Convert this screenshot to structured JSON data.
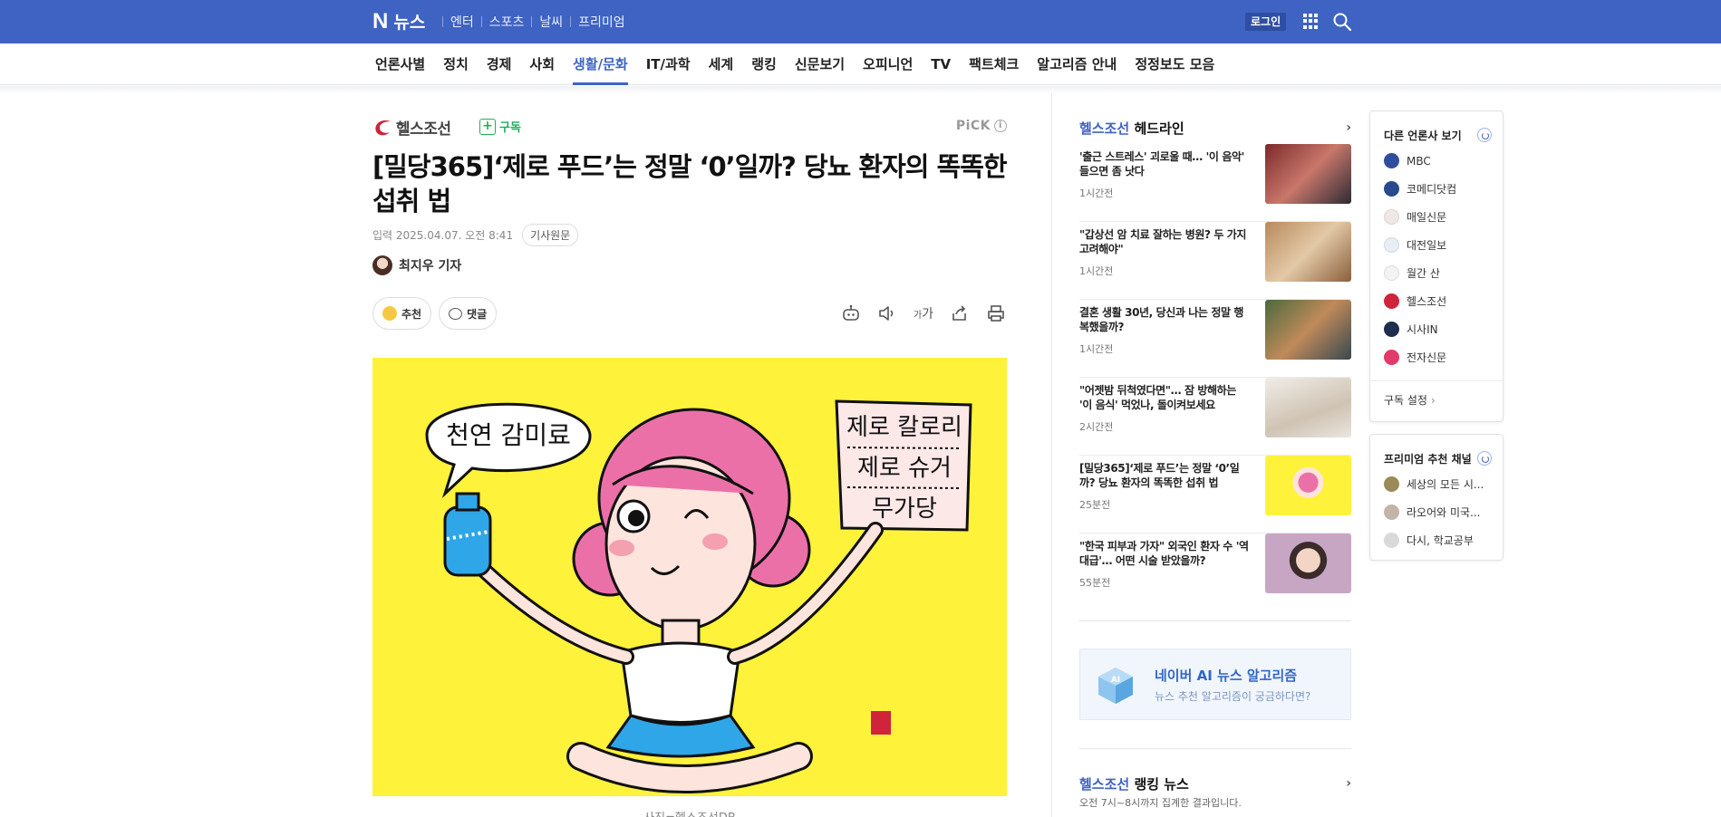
{
  "topbar": {
    "logo_n": "N",
    "logo_text": "뉴스",
    "services": [
      "엔터",
      "스포츠",
      "날씨",
      "프리미엄"
    ],
    "login": "로그인"
  },
  "nav": {
    "items": [
      "언론사별",
      "정치",
      "경제",
      "사회",
      "생활/문화",
      "IT/과학",
      "세계",
      "랭킹",
      "신문보기",
      "오피니언",
      "TV",
      "팩트체크",
      "알고리즘 안내",
      "정정보도 모음"
    ],
    "active": "생활/문화"
  },
  "article": {
    "press": "헬스조선",
    "subscribe": "구독",
    "pick": "PiCK",
    "headline": "[밀당365]‘제로 푸드’는 정말 ‘0’일까? 당뇨 환자의 똑똑한 섭취 법",
    "date": "입력 2025.04.07. 오전 8:41",
    "original": "기사원문",
    "reporter": "최지우 기자",
    "like": "추천",
    "comment": "댓글",
    "font_tool": "가",
    "image_bubble": "천연 감미료",
    "image_sign": [
      "제로 칼로리",
      "제로 슈거",
      "무가당"
    ],
    "caption": "사진=헬스조선DB"
  },
  "headlines": {
    "press": "헬스조선",
    "title": "헤드라인",
    "items": [
      {
        "text": "'출근 스트레스' 괴로울 때… '이 음악' 들으면 좀 낫다",
        "time": "1시간전",
        "color": "#b94a3c"
      },
      {
        "text": "\"갑상선 암 치료 잘하는 병원? 두 가지 고려해야\"",
        "time": "1시간전",
        "color": "#c89b6d"
      },
      {
        "text": "결혼 생활 30년, 당신과 나는 정말 행복했을까?",
        "time": "1시간전",
        "color": "#6c8a5c"
      },
      {
        "text": "\"어젯밤 뒤척였다면\"… 잠 방해하는 '이 음식' 먹었나, 돌이켜보세요",
        "time": "2시간전",
        "color": "#e8e3dc"
      },
      {
        "text": "[밀당365]‘제로 푸드’는 정말 ‘0’일까? 당뇨 환자의 똑똑한 섭취 법",
        "time": "25분전",
        "color": "#fff23a"
      },
      {
        "text": "\"한국 피부과 가자\" 외국인 환자 수 '역대급'… 어떤 시술 받았을까?",
        "time": "55분전",
        "color": "#c7a6c4"
      }
    ]
  },
  "ai_banner": {
    "title": "네이버 AI 뉴스 알고리즘",
    "sub": "뉴스 추천 알고리즘이 궁금하다면?",
    "icon_text": "AI"
  },
  "ranking": {
    "press": "헬스조선",
    "title": "랭킹 뉴스",
    "sub": "오전 7시~8시까지 집계한 결과입니다."
  },
  "other_press": {
    "title": "다른 언론사 보기",
    "items": [
      {
        "name": "MBC",
        "color": "#2f4f9e"
      },
      {
        "name": "코메디닷컴",
        "color": "#274b8c"
      },
      {
        "name": "매일신문",
        "color": "#f0e8e8"
      },
      {
        "name": "대전일보",
        "color": "#e8eef5"
      },
      {
        "name": "월간 산",
        "color": "#f3f3f3"
      },
      {
        "name": "헬스조선",
        "color": "#d0243a"
      },
      {
        "name": "시사IN",
        "color": "#1f2d4e"
      },
      {
        "name": "전자신문",
        "color": "#e23a6b"
      }
    ],
    "footer": "구독 설정"
  },
  "premium": {
    "title": "프리미엄 추천 채널",
    "items": [
      {
        "name": "세상의 모든 시...",
        "color": "#9b8a5a"
      },
      {
        "name": "라오어와 미국...",
        "color": "#c4b4a8"
      },
      {
        "name": "다시, 학교공부",
        "color": "#d9d9d9"
      }
    ]
  }
}
